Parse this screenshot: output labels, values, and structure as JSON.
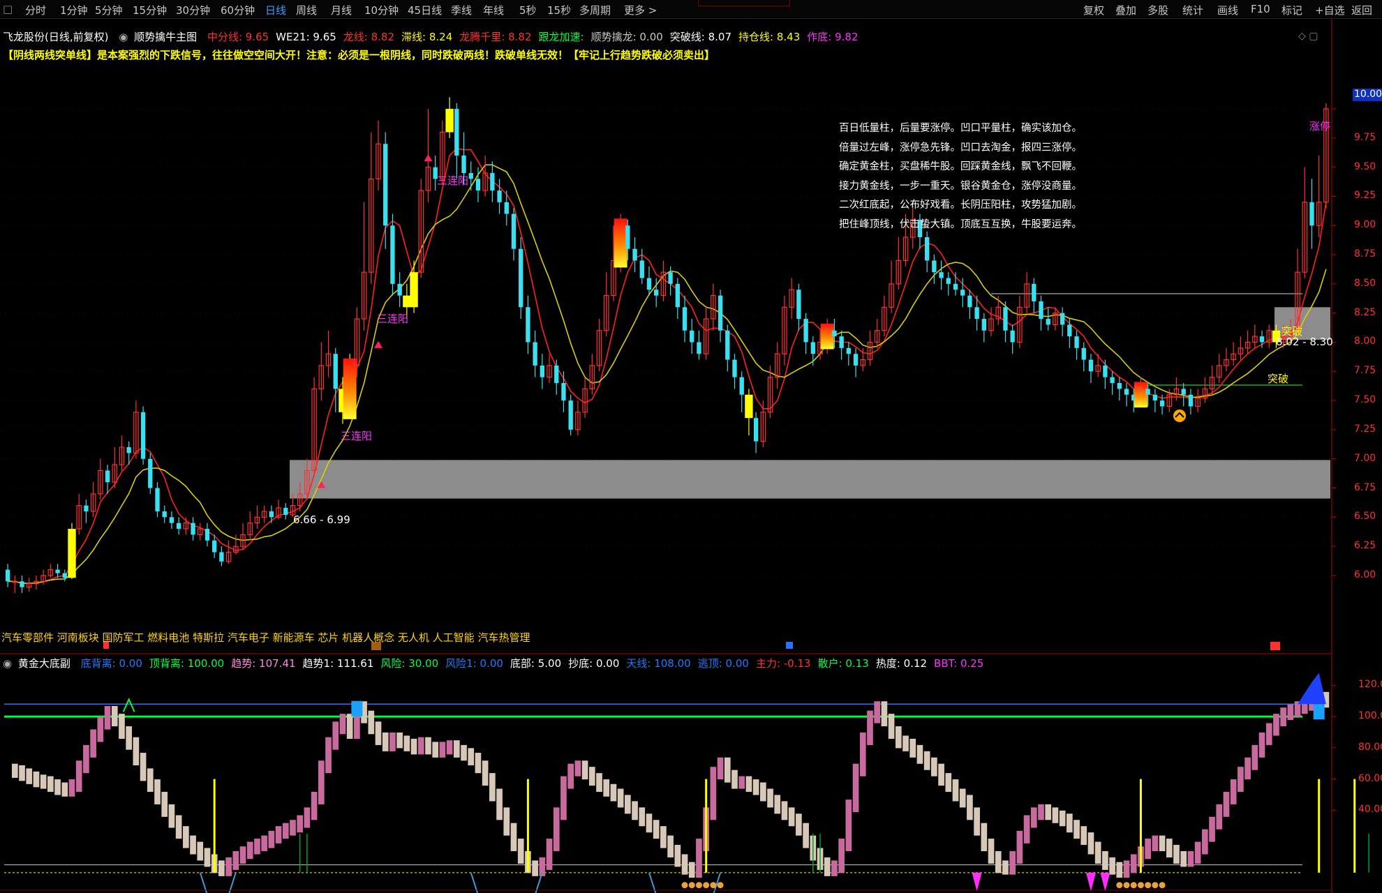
{
  "toolbar": {
    "periods": [
      "分时",
      "1分钟",
      "5分钟",
      "15分钟",
      "30分钟",
      "60分钟",
      "日线",
      "周线",
      "月线",
      "10分钟",
      "45日线",
      "季线",
      "年线",
      "5秒",
      "15秒",
      "多周期",
      "更多 >"
    ],
    "active_period": "日线",
    "right_buttons": [
      "复权",
      "叠加",
      "多股",
      "统计",
      "画线",
      "F10",
      "标记",
      "+自选",
      "返回"
    ]
  },
  "main_info": {
    "title": "飞龙股份(日线,前复权)",
    "indicator_name": "顺势擒牛主图",
    "items": [
      {
        "label": "中分线: 9.65",
        "color": "#ff3030"
      },
      {
        "label": "WE21: 9.65",
        "color": "#ffffff"
      },
      {
        "label": "龙线: 8.82",
        "color": "#ff3030"
      },
      {
        "label": "滞线: 8.24",
        "color": "#ffff00"
      },
      {
        "label": "龙腾千里: 8.82",
        "color": "#ff3030"
      },
      {
        "label": "跟龙加速:",
        "color": "#00ff40"
      },
      {
        "label": "顺势擒龙: 0.00",
        "color": "#c8c8c8"
      },
      {
        "label": "突破线: 8.07",
        "color": "#ffffff"
      },
      {
        "label": "持仓线: 8.43",
        "color": "#ffff00"
      },
      {
        "label": "作底: 9.82",
        "color": "#ff30ff"
      }
    ]
  },
  "warning_text": "【阴线两线突单线】是本案强烈的下跌信号，往往做空空间大开！注意：必须是一根阴线，同时跌破两线！跌破单线无效！【牢记上行趋势跌破必须卖出】",
  "price_axis": [
    "10.00",
    "9.75",
    "9.50",
    "9.25",
    "9.00",
    "8.75",
    "8.50",
    "8.25",
    "8.00",
    "7.75",
    "7.50",
    "7.25",
    "7.00",
    "6.75",
    "6.50",
    "6.25",
    "6.00"
  ],
  "price_box": "10.00",
  "annotations": [
    {
      "name": "label-sanlianyang-1",
      "text": "三连阳",
      "color": "#ff30ff"
    },
    {
      "name": "label-sanlianyang-2",
      "text": "三连阳",
      "color": "#ff30ff"
    },
    {
      "name": "label-sanlianyang-3",
      "text": "三连阳",
      "color": "#ff30ff"
    },
    {
      "name": "label-zhangting",
      "text": "涨停",
      "color": "#ff30ff"
    },
    {
      "name": "label-tupo-1",
      "text": "突破",
      "color": "#ffff00"
    },
    {
      "name": "label-tupo-2",
      "text": "突破",
      "color": "#ffff00"
    },
    {
      "name": "label-zone-low",
      "text": "6.66 - 6.99",
      "color": "#ffffff"
    },
    {
      "name": "label-zone-high",
      "text": "8.02 - 8.30",
      "color": "#ffffff"
    }
  ],
  "poem_lines": [
    "百日低量柱，后量要涨停。凹口平量柱，确实该加仓。",
    "倍量过左峰，涨停急先锋。凹口去淘金，报四三涨停。",
    "确定黄金柱，买盘稀牛股。回踩黄金线，飘飞不回鞭。",
    "接力黄金线，一步一重天。银谷黄金仓，涨停没商量。",
    "二次红底起，公布好戏看。长阴压阳柱，攻势猛加剧。",
    "把住峰顶线，伏击蛰大镇。顶底互互换，牛股要运奔。"
  ],
  "sectors": "汽车零部件 河南板块   国防军工 燃料电池 特斯拉 汽车电子 新能源车 芯片 机器人概念 无人机 人工智能 汽车热管理",
  "sub_info": {
    "title": "黄金大底副",
    "items": [
      {
        "label": "底背离: 0.00",
        "color": "#1e7bff"
      },
      {
        "label": "顶背离: 100.00",
        "color": "#00ff40"
      },
      {
        "label": "趋势: 107.41",
        "color": "#ff8ad8"
      },
      {
        "label": "趋势1: 111.61",
        "color": "#ffffff"
      },
      {
        "label": "风险: 30.00",
        "color": "#00ff40"
      },
      {
        "label": "风险1: 0.00",
        "color": "#1e7bff"
      },
      {
        "label": "底部: 5.00",
        "color": "#ffffff"
      },
      {
        "label": "抄底: 0.00",
        "color": "#ffffff"
      },
      {
        "label": "天线: 108.00",
        "color": "#1e7bff"
      },
      {
        "label": "逃顶: 0.00",
        "color": "#1e7bff"
      },
      {
        "label": "主力: -0.13",
        "color": "#ff3030"
      },
      {
        "label": "散户: 0.13",
        "color": "#00ff40"
      },
      {
        "label": "热度: 0.12",
        "color": "#ffffff"
      },
      {
        "label": "BBT: 0.25",
        "color": "#ff30ff"
      }
    ]
  },
  "sub_axis": [
    "120.00",
    "100.00",
    "80.00",
    "60.00",
    "40.00"
  ],
  "colors": {
    "up": "#ff3030",
    "down": "#38e0f0",
    "yellow": "#ffff00",
    "bg": "#000000"
  },
  "chart_data": {
    "type": "candlestick",
    "y_range": [
      5.85,
      10.12
    ],
    "candles": [
      [
        6.05,
        5.95,
        6.1,
        5.9
      ],
      [
        5.95,
        5.95,
        6.0,
        5.85
      ],
      [
        5.95,
        5.9,
        6.0,
        5.85
      ],
      [
        5.9,
        5.93,
        5.98,
        5.86
      ],
      [
        5.93,
        5.95,
        6.0,
        5.88
      ],
      [
        5.95,
        6.0,
        6.05,
        5.92
      ],
      [
        6.0,
        6.05,
        6.1,
        5.98
      ],
      [
        6.05,
        6.02,
        6.1,
        5.98
      ],
      [
        6.02,
        5.98,
        6.05,
        5.95
      ],
      [
        5.98,
        6.4,
        6.45,
        5.97
      ],
      [
        6.4,
        6.6,
        6.7,
        6.35
      ],
      [
        6.6,
        6.55,
        6.65,
        6.45
      ],
      [
        6.55,
        6.7,
        6.8,
        6.5
      ],
      [
        6.7,
        6.9,
        7.0,
        6.65
      ],
      [
        6.9,
        6.8,
        6.95,
        6.7
      ],
      [
        6.8,
        6.95,
        7.1,
        6.75
      ],
      [
        6.95,
        7.1,
        7.2,
        6.9
      ],
      [
        7.1,
        7.05,
        7.15,
        6.95
      ],
      [
        7.05,
        7.4,
        7.5,
        7.0
      ],
      [
        7.4,
        7.0,
        7.45,
        6.95
      ],
      [
        7.0,
        6.75,
        7.05,
        6.7
      ],
      [
        6.75,
        6.55,
        6.8,
        6.5
      ],
      [
        6.55,
        6.5,
        6.6,
        6.45
      ],
      [
        6.5,
        6.45,
        6.55,
        6.4
      ],
      [
        6.45,
        6.4,
        6.5,
        6.35
      ],
      [
        6.4,
        6.45,
        6.5,
        6.35
      ],
      [
        6.45,
        6.35,
        6.5,
        6.3
      ],
      [
        6.35,
        6.4,
        6.45,
        6.3
      ],
      [
        6.4,
        6.3,
        6.45,
        6.25
      ],
      [
        6.3,
        6.2,
        6.35,
        6.15
      ],
      [
        6.2,
        6.12,
        6.25,
        6.08
      ],
      [
        6.12,
        6.2,
        6.3,
        6.1
      ],
      [
        6.2,
        6.25,
        6.35,
        6.18
      ],
      [
        6.25,
        6.35,
        6.45,
        6.22
      ],
      [
        6.35,
        6.45,
        6.55,
        6.3
      ],
      [
        6.45,
        6.5,
        6.6,
        6.4
      ],
      [
        6.5,
        6.55,
        6.6,
        6.45
      ],
      [
        6.55,
        6.5,
        6.6,
        6.45
      ],
      [
        6.5,
        6.58,
        6.65,
        6.48
      ],
      [
        6.58,
        6.52,
        6.62,
        6.48
      ],
      [
        6.52,
        6.6,
        6.7,
        6.5
      ],
      [
        6.6,
        6.7,
        6.8,
        6.55
      ],
      [
        6.7,
        6.9,
        7.0,
        6.65
      ],
      [
        6.9,
        7.6,
        7.7,
        6.85
      ],
      [
        7.6,
        7.8,
        8.0,
        7.5
      ],
      [
        7.8,
        7.9,
        8.1,
        7.7
      ],
      [
        7.9,
        7.6,
        7.95,
        7.4
      ],
      [
        7.6,
        7.4,
        7.7,
        7.3
      ],
      [
        7.4,
        7.8,
        7.9,
        7.35
      ],
      [
        7.8,
        8.2,
        8.3,
        7.7
      ],
      [
        8.2,
        8.6,
        9.2,
        8.1
      ],
      [
        8.6,
        9.4,
        9.8,
        8.5
      ],
      [
        9.4,
        9.7,
        9.9,
        9.3
      ],
      [
        9.7,
        9.0,
        9.8,
        8.8
      ],
      [
        9.0,
        8.5,
        9.1,
        8.4
      ],
      [
        8.5,
        8.4,
        8.6,
        8.3
      ],
      [
        8.4,
        8.3,
        8.5,
        8.2
      ],
      [
        8.3,
        8.6,
        8.7,
        8.25
      ],
      [
        8.6,
        9.3,
        9.4,
        8.55
      ],
      [
        9.3,
        9.5,
        10.0,
        9.2
      ],
      [
        9.5,
        9.4,
        9.6,
        9.3
      ],
      [
        9.4,
        9.8,
        9.9,
        9.35
      ],
      [
        9.8,
        10.0,
        10.1,
        9.75
      ],
      [
        10.0,
        9.6,
        10.05,
        9.4
      ],
      [
        9.6,
        9.45,
        9.8,
        9.35
      ],
      [
        9.45,
        9.4,
        9.55,
        9.3
      ],
      [
        9.4,
        9.3,
        9.5,
        9.2
      ],
      [
        9.3,
        9.45,
        9.6,
        9.25
      ],
      [
        9.45,
        9.3,
        9.55,
        9.2
      ],
      [
        9.3,
        9.2,
        9.4,
        9.1
      ],
      [
        9.2,
        9.1,
        9.3,
        9.0
      ],
      [
        9.1,
        8.8,
        9.15,
        8.7
      ],
      [
        8.8,
        8.3,
        8.9,
        8.2
      ],
      [
        8.3,
        8.0,
        8.4,
        7.9
      ],
      [
        8.0,
        7.8,
        8.1,
        7.7
      ],
      [
        7.8,
        7.7,
        7.9,
        7.6
      ],
      [
        7.7,
        7.8,
        7.9,
        7.65
      ],
      [
        7.8,
        7.65,
        7.85,
        7.55
      ],
      [
        7.65,
        7.5,
        7.75,
        7.4
      ],
      [
        7.5,
        7.25,
        7.55,
        7.2
      ],
      [
        7.25,
        7.4,
        7.5,
        7.2
      ],
      [
        7.4,
        7.6,
        7.7,
        7.35
      ],
      [
        7.6,
        7.8,
        7.9,
        7.55
      ],
      [
        7.8,
        8.1,
        8.2,
        7.75
      ],
      [
        8.1,
        8.4,
        8.6,
        8.05
      ],
      [
        8.4,
        8.7,
        9.0,
        8.35
      ],
      [
        8.7,
        9.0,
        9.1,
        8.6
      ],
      [
        9.0,
        8.8,
        9.05,
        8.7
      ],
      [
        8.8,
        8.7,
        8.9,
        8.6
      ],
      [
        8.7,
        8.55,
        8.8,
        8.5
      ],
      [
        8.55,
        8.45,
        8.65,
        8.4
      ],
      [
        8.45,
        8.4,
        8.55,
        8.3
      ],
      [
        8.4,
        8.6,
        8.7,
        8.35
      ],
      [
        8.6,
        8.5,
        8.65,
        8.4
      ],
      [
        8.5,
        8.3,
        8.55,
        8.2
      ],
      [
        8.3,
        8.1,
        8.4,
        8.0
      ],
      [
        8.1,
        8.0,
        8.2,
        7.9
      ],
      [
        8.0,
        7.9,
        8.1,
        7.85
      ],
      [
        7.9,
        8.2,
        8.3,
        7.85
      ],
      [
        8.2,
        8.4,
        8.5,
        8.1
      ],
      [
        8.4,
        8.1,
        8.45,
        8.0
      ],
      [
        8.1,
        7.85,
        8.15,
        7.75
      ],
      [
        7.85,
        7.7,
        7.9,
        7.6
      ],
      [
        7.7,
        7.55,
        7.75,
        7.4
      ],
      [
        7.55,
        7.35,
        7.6,
        7.2
      ],
      [
        7.35,
        7.15,
        7.4,
        7.05
      ],
      [
        7.15,
        7.4,
        7.5,
        7.1
      ],
      [
        7.4,
        7.7,
        7.8,
        7.35
      ],
      [
        7.7,
        7.9,
        8.0,
        7.6
      ],
      [
        7.9,
        8.3,
        8.4,
        7.8
      ],
      [
        8.3,
        8.45,
        8.55,
        8.2
      ],
      [
        8.45,
        8.2,
        8.5,
        8.1
      ],
      [
        8.2,
        8.0,
        8.25,
        7.9
      ],
      [
        8.0,
        7.9,
        8.05,
        7.8
      ],
      [
        7.9,
        8.0,
        8.1,
        7.85
      ],
      [
        8.0,
        8.1,
        8.2,
        7.9
      ],
      [
        8.1,
        8.05,
        8.2,
        7.95
      ],
      [
        8.05,
        7.95,
        8.1,
        7.85
      ],
      [
        7.95,
        7.9,
        8.0,
        7.8
      ],
      [
        7.9,
        7.8,
        7.95,
        7.7
      ],
      [
        7.8,
        7.85,
        7.95,
        7.75
      ],
      [
        7.85,
        8.0,
        8.1,
        7.8
      ],
      [
        8.0,
        8.1,
        8.2,
        7.95
      ],
      [
        8.1,
        8.3,
        8.4,
        8.05
      ],
      [
        8.3,
        8.5,
        8.7,
        8.25
      ],
      [
        8.5,
        8.7,
        8.9,
        8.45
      ],
      [
        8.7,
        8.9,
        9.1,
        8.65
      ],
      [
        8.9,
        9.05,
        9.2,
        8.8
      ],
      [
        9.05,
        8.9,
        9.1,
        8.8
      ],
      [
        8.9,
        8.7,
        8.95,
        8.6
      ],
      [
        8.7,
        8.6,
        8.75,
        8.5
      ],
      [
        8.6,
        8.55,
        8.7,
        8.45
      ],
      [
        8.55,
        8.5,
        8.6,
        8.4
      ],
      [
        8.5,
        8.45,
        8.6,
        8.4
      ],
      [
        8.45,
        8.4,
        8.55,
        8.3
      ],
      [
        8.4,
        8.3,
        8.45,
        8.2
      ],
      [
        8.3,
        8.2,
        8.4,
        8.1
      ],
      [
        8.2,
        8.1,
        8.25,
        8.0
      ],
      [
        8.1,
        8.2,
        8.3,
        8.05
      ],
      [
        8.2,
        8.3,
        8.4,
        8.15
      ],
      [
        8.3,
        8.1,
        8.35,
        8.0
      ],
      [
        8.1,
        8.0,
        8.15,
        7.9
      ],
      [
        8.0,
        8.3,
        8.4,
        7.95
      ],
      [
        8.3,
        8.5,
        8.6,
        8.25
      ],
      [
        8.5,
        8.35,
        8.55,
        8.25
      ],
      [
        8.35,
        8.2,
        8.4,
        8.1
      ],
      [
        8.2,
        8.15,
        8.3,
        8.1
      ],
      [
        8.15,
        8.25,
        8.3,
        8.1
      ],
      [
        8.25,
        8.15,
        8.3,
        8.05
      ],
      [
        8.15,
        8.05,
        8.2,
        7.95
      ],
      [
        8.05,
        7.95,
        8.1,
        7.85
      ],
      [
        7.95,
        7.85,
        8.0,
        7.75
      ],
      [
        7.85,
        7.75,
        7.9,
        7.65
      ],
      [
        7.75,
        7.8,
        7.9,
        7.7
      ],
      [
        7.8,
        7.7,
        7.85,
        7.6
      ],
      [
        7.7,
        7.65,
        7.75,
        7.55
      ],
      [
        7.65,
        7.6,
        7.7,
        7.5
      ],
      [
        7.6,
        7.55,
        7.65,
        7.45
      ],
      [
        7.55,
        7.5,
        7.6,
        7.4
      ],
      [
        7.5,
        7.6,
        7.7,
        7.45
      ],
      [
        7.6,
        7.55,
        7.65,
        7.45
      ],
      [
        7.55,
        7.5,
        7.6,
        7.4
      ],
      [
        7.5,
        7.45,
        7.55,
        7.38
      ],
      [
        7.45,
        7.55,
        7.6,
        7.4
      ],
      [
        7.55,
        7.6,
        7.7,
        7.5
      ],
      [
        7.6,
        7.55,
        7.65,
        7.45
      ],
      [
        7.55,
        7.45,
        7.6,
        7.38
      ],
      [
        7.45,
        7.52,
        7.6,
        7.4
      ],
      [
        7.52,
        7.6,
        7.7,
        7.48
      ],
      [
        7.6,
        7.7,
        7.8,
        7.55
      ],
      [
        7.7,
        7.8,
        7.9,
        7.65
      ],
      [
        7.8,
        7.85,
        7.95,
        7.75
      ],
      [
        7.85,
        7.9,
        8.0,
        7.8
      ],
      [
        7.9,
        7.95,
        8.05,
        7.85
      ],
      [
        7.95,
        8.0,
        8.1,
        7.9
      ],
      [
        8.0,
        8.05,
        8.15,
        7.95
      ],
      [
        8.05,
        8.0,
        8.1,
        7.95
      ],
      [
        8.0,
        8.1,
        8.15,
        7.95
      ],
      [
        8.1,
        8.0,
        8.15,
        7.95
      ],
      [
        8.0,
        8.05,
        8.15,
        7.95
      ],
      [
        8.05,
        8.1,
        8.2,
        8.0
      ],
      [
        8.1,
        8.6,
        8.8,
        8.05
      ],
      [
        8.6,
        9.2,
        9.5,
        8.55
      ],
      [
        9.2,
        9.0,
        9.4,
        8.8
      ],
      [
        9.0,
        9.2,
        9.6,
        8.9
      ],
      [
        9.2,
        10.0,
        10.05,
        9.15
      ]
    ],
    "yellow_bars": [
      9,
      47,
      48,
      56,
      57,
      62,
      104,
      178,
      186,
      190,
      191
    ],
    "fire_bars": [
      48,
      86,
      115,
      159
    ],
    "zones": [
      {
        "low": 6.66,
        "high": 6.99
      },
      {
        "low": 8.02,
        "high": 8.3
      }
    ],
    "sub_y_range": [
      -5,
      130
    ],
    "sub_values": [
      68,
      67,
      65,
      63,
      61,
      60,
      58,
      56,
      55,
      58,
      70,
      80,
      90,
      98,
      105,
      100,
      92,
      85,
      75,
      65,
      58,
      50,
      42,
      35,
      28,
      22,
      18,
      14,
      10,
      6,
      4,
      8,
      12,
      15,
      18,
      20,
      22,
      25,
      28,
      30,
      32,
      35,
      40,
      50,
      70,
      85,
      95,
      100,
      92,
      108,
      102,
      95,
      88,
      84,
      88,
      86,
      84,
      82,
      85,
      82,
      80,
      82,
      83,
      80,
      78,
      75,
      70,
      62,
      52,
      40,
      30,
      20,
      12,
      6,
      4,
      8,
      20,
      40,
      60,
      68,
      70,
      66,
      62,
      58,
      55,
      52,
      48,
      44,
      40,
      36,
      32,
      28,
      22,
      16,
      10,
      5,
      3,
      20,
      40,
      66,
      72,
      64,
      60,
      60,
      58,
      56,
      52,
      48,
      44,
      40,
      36,
      30,
      22,
      14,
      8,
      4,
      6,
      20,
      45,
      68,
      88,
      102,
      108,
      100,
      92,
      86,
      84,
      80,
      76,
      72,
      68,
      62,
      58,
      52,
      48,
      40,
      30,
      20,
      12,
      6,
      5,
      12,
      25,
      35,
      40,
      42,
      40,
      38,
      36,
      32,
      28,
      24,
      18,
      12,
      8,
      5,
      3,
      6,
      10,
      15,
      20,
      22,
      20,
      16,
      12,
      10,
      12,
      18,
      26,
      34,
      42,
      50,
      58,
      66,
      72,
      80,
      88,
      94,
      100,
      104,
      106,
      108,
      110,
      112,
      114,
      112
    ]
  }
}
